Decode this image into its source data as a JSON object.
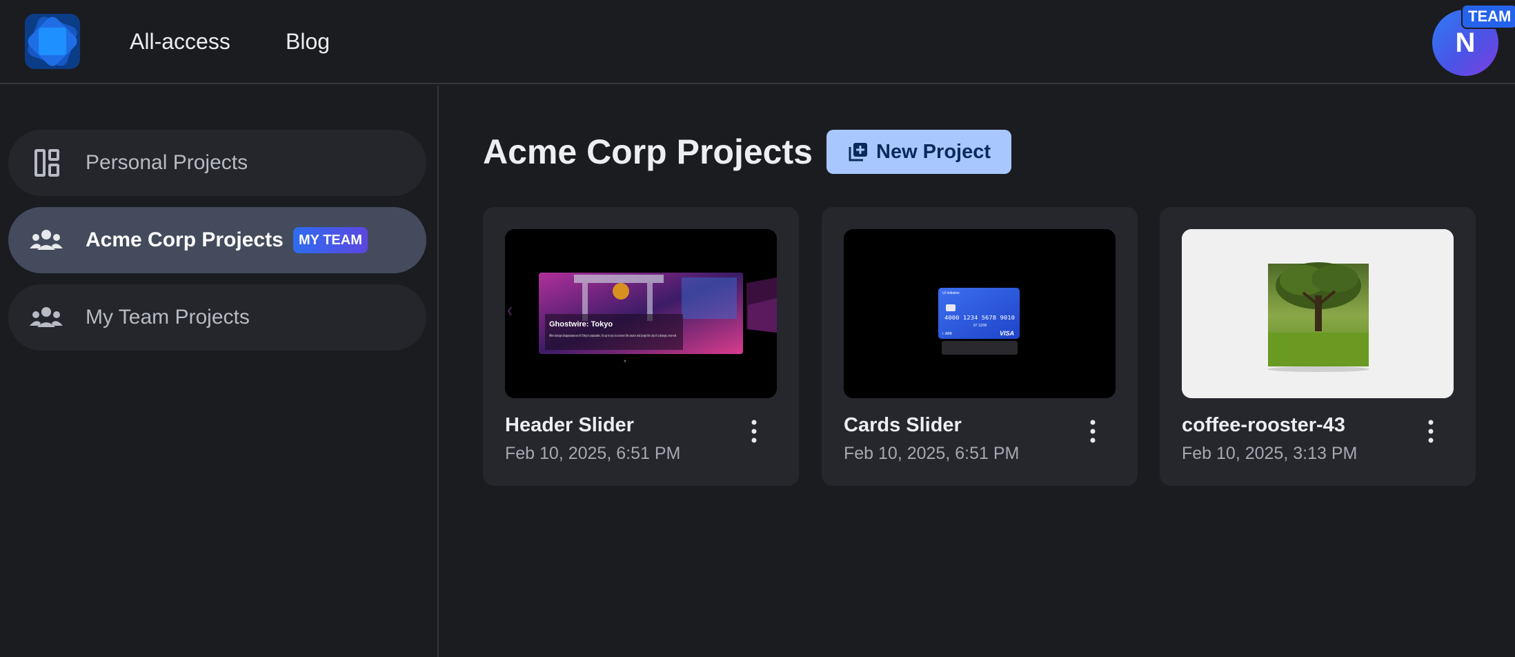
{
  "header": {
    "nav": [
      "All-access",
      "Blog"
    ],
    "avatar_initial": "N",
    "team_badge": "TEAM"
  },
  "sidebar": {
    "items": [
      {
        "label": "Personal Projects",
        "icon": "dashboard-icon",
        "active": false
      },
      {
        "label": "Acme Corp Projects",
        "icon": "group-icon",
        "active": true,
        "badge": "MY TEAM"
      },
      {
        "label": "My Team Projects",
        "icon": "group-icon",
        "active": false
      }
    ]
  },
  "main": {
    "title": "Acme Corp Projects",
    "new_project_label": "New Project",
    "projects": [
      {
        "name": "Header Slider",
        "date": "Feb 10, 2025, 6:51 PM",
        "thumb_title": "Ghostwire: Tokyo",
        "thumb_text": "After strange disappearances hit Tokyo's population, it's up to you to uncover the source and purge the city of a strange, new evil."
      },
      {
        "name": "Cards Slider",
        "date": "Feb 10, 2025, 6:51 PM",
        "card_name": "UI Initiative",
        "card_number": "4000 1234 5678 9010",
        "card_exp": "07 12/30",
        "card_holder": "I. ABB",
        "card_brand": "VISA"
      },
      {
        "name": "coffee-rooster-43",
        "date": "Feb 10, 2025, 3:13 PM"
      }
    ]
  },
  "colors": {
    "background": "#1b1c20",
    "accent": "#a9c7ff",
    "active_item": "#434b5c"
  }
}
